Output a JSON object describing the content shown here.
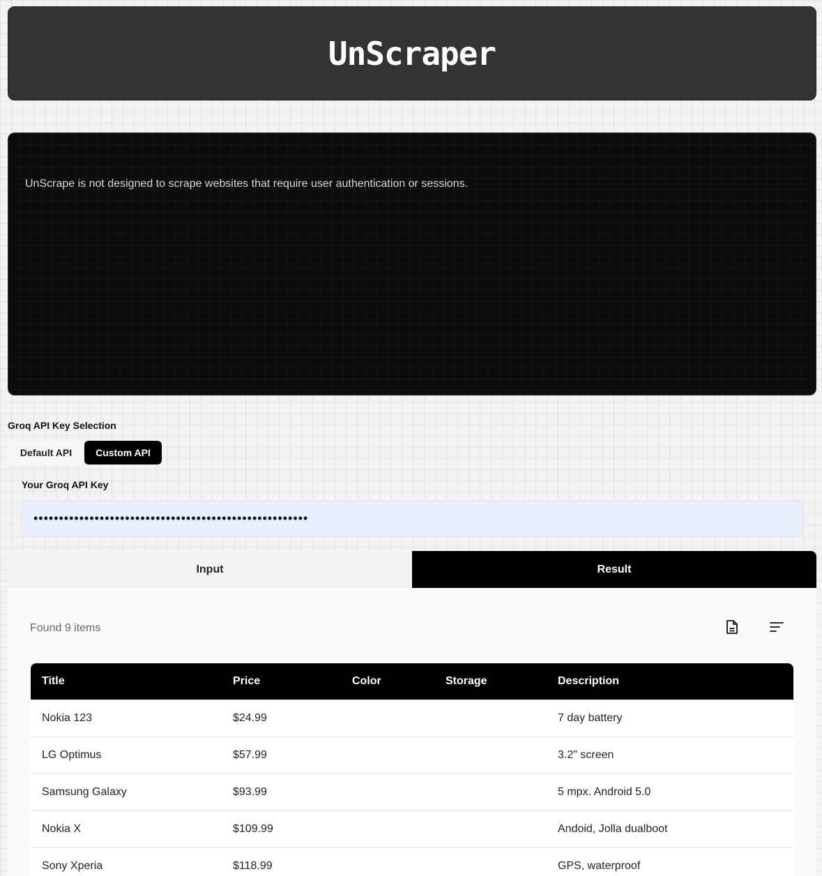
{
  "app": {
    "title": "UnScraper"
  },
  "notice": {
    "text": "UnScrape is not designed to scrape websites that require user authentication or sessions."
  },
  "api_selection": {
    "label": "Groq API Key Selection",
    "options": [
      "Default API",
      "Custom API"
    ],
    "selected": "Custom API"
  },
  "api_key": {
    "label": "Your Groq API Key",
    "value": "••••••••••••••••••••••••••••••••••••••••••••••••••••••"
  },
  "tabs": {
    "input": "Input",
    "result": "Result",
    "active": "Result"
  },
  "result": {
    "summary": "Found 9 items",
    "icons": [
      "document-icon",
      "lines-icon"
    ],
    "columns": [
      "Title",
      "Price",
      "Color",
      "Storage",
      "Description"
    ],
    "rows": [
      [
        "Nokia 123",
        "$24.99",
        "",
        "",
        "7 day battery"
      ],
      [
        "LG Optimus",
        "$57.99",
        "",
        "",
        "3.2\" screen"
      ],
      [
        "Samsung Galaxy",
        "$93.99",
        "",
        "",
        "5 mpx. Android 5.0"
      ],
      [
        "Nokia X",
        "$109.99",
        "",
        "",
        "Andoid, Jolla dualboot"
      ],
      [
        "Sony Xperia",
        "$118.99",
        "",
        "",
        "GPS, waterproof"
      ]
    ]
  }
}
